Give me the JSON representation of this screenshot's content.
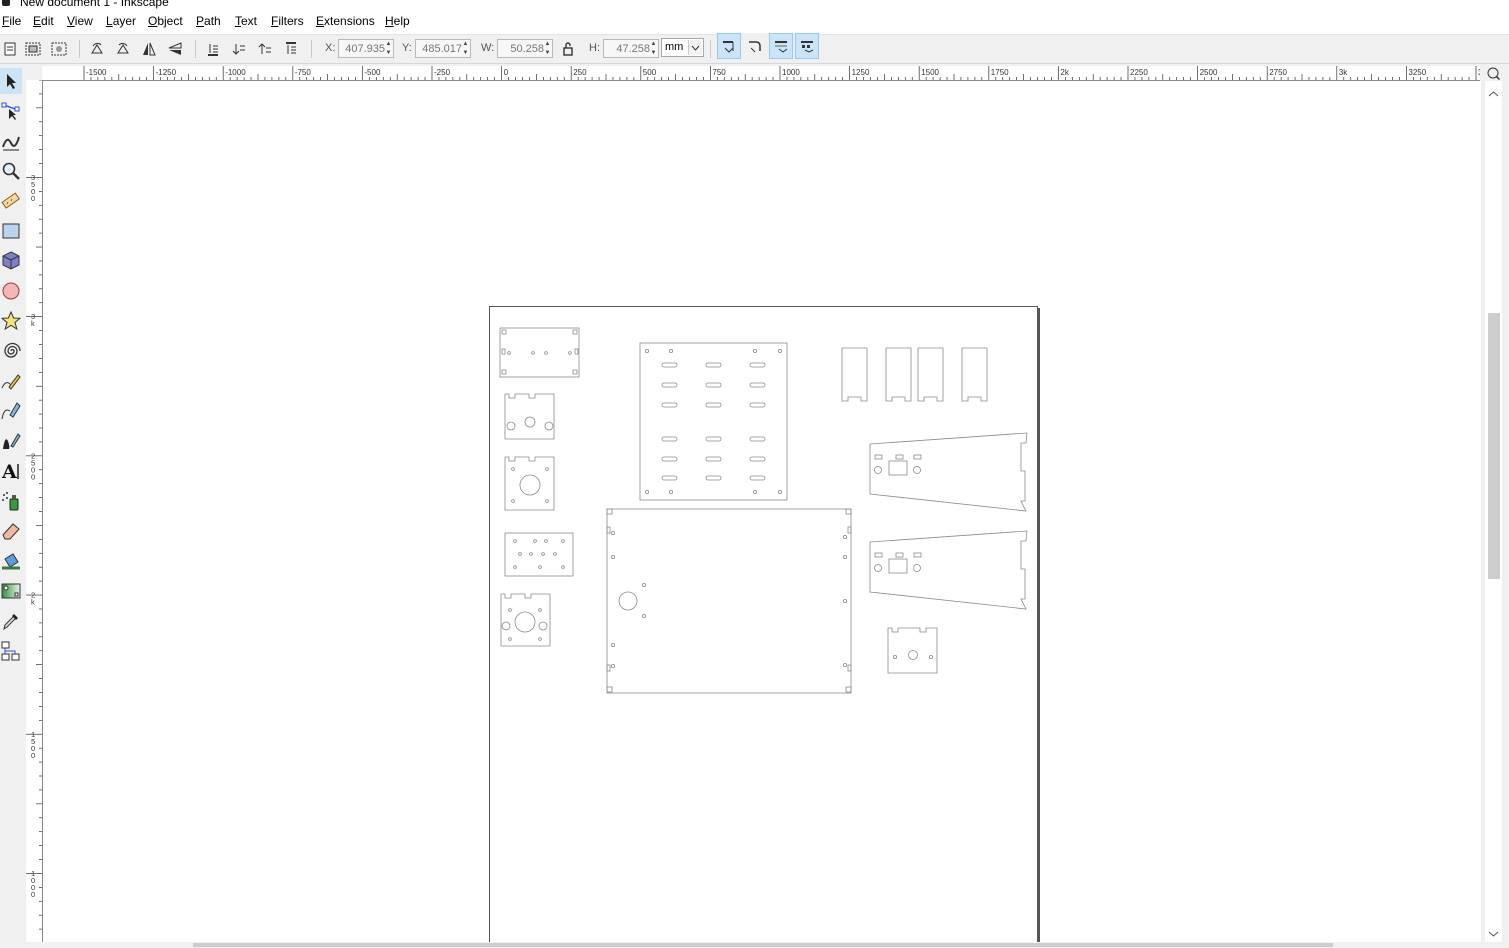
{
  "window": {
    "title": "New document 1 - Inkscape"
  },
  "menubar": {
    "items": [
      {
        "label": "File"
      },
      {
        "label": "Edit"
      },
      {
        "label": "View"
      },
      {
        "label": "Layer"
      },
      {
        "label": "Object"
      },
      {
        "label": "Path"
      },
      {
        "label": "Text"
      },
      {
        "label": "Filters"
      },
      {
        "label": "Extensions"
      },
      {
        "label": "Help"
      }
    ]
  },
  "controls": {
    "x": {
      "label": "X:",
      "value": "407.935"
    },
    "y": {
      "label": "Y:",
      "value": "485.017"
    },
    "w": {
      "label": "W:",
      "value": "50.258"
    },
    "h": {
      "label": "H:",
      "value": "47.258"
    },
    "unit": "mm"
  },
  "rulers": {
    "horizontal": [
      "-1500",
      "-1250",
      "-1000",
      "-750",
      "-500",
      "-250",
      "0",
      "250",
      "500",
      "750",
      "1000",
      "1250",
      "1500",
      "1750",
      "2k",
      "2250",
      "2500",
      "2750",
      "3k",
      "3250",
      "3500"
    ],
    "vertical": [
      "3500",
      "3k",
      "2500",
      "2k",
      "1500",
      "1000"
    ]
  },
  "toolbox": {
    "tools": [
      "selector-tool",
      "node-tool",
      "tweak-tool",
      "zoom-tool",
      "measure-tool",
      "rectangle-tool",
      "3dbox-tool",
      "ellipse-tool",
      "star-tool",
      "spiral-tool",
      "pencil-tool",
      "pen-tool",
      "calligraphy-tool",
      "text-tool",
      "spray-tool",
      "eraser-tool",
      "paint-bucket-tool",
      "gradient-tool",
      "dropper-tool",
      "connector-tool"
    ]
  },
  "colors": {
    "accent": "#cce4f7",
    "page_border": "#555555",
    "drawing_stroke": "#888888"
  }
}
